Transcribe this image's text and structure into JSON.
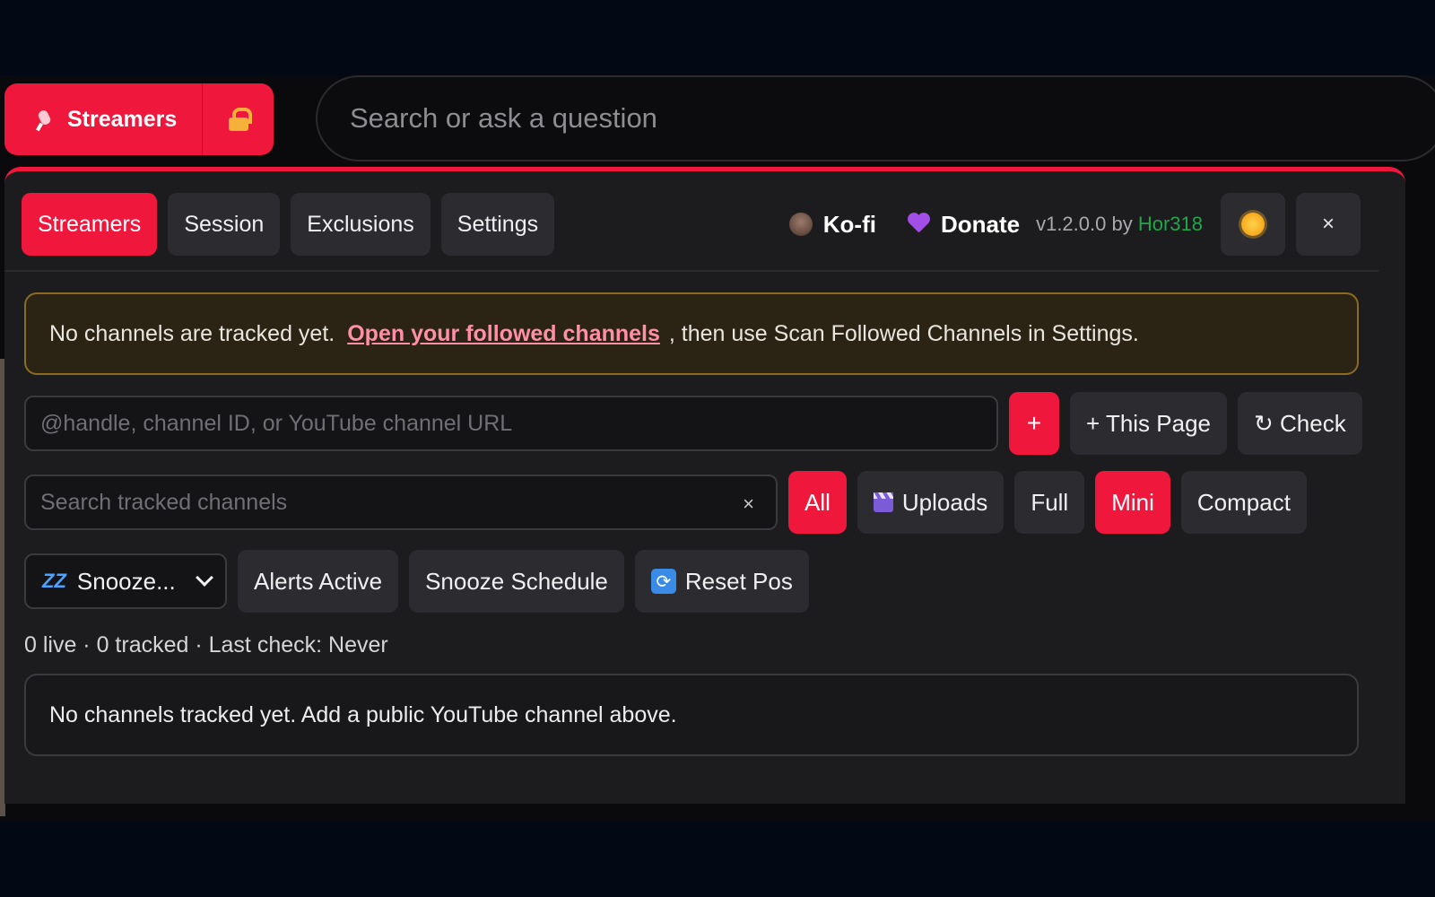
{
  "topbar": {
    "app_button_label": "Streamers",
    "app_button_icon": "microphone-icon",
    "lock_icon": "lock-icon",
    "search_placeholder": "Search or ask a question"
  },
  "tabs": [
    {
      "label": "Streamers",
      "active": true
    },
    {
      "label": "Session",
      "active": false
    },
    {
      "label": "Exclusions",
      "active": false
    },
    {
      "label": "Settings",
      "active": false
    }
  ],
  "header": {
    "kofi_label": "Ko-fi",
    "donate_label": "Donate",
    "version_prefix": "v1.2.0.0 by",
    "author": "Hor318",
    "theme_icon": "sun-icon",
    "close_label": "×"
  },
  "notice": {
    "text_before": "No channels are tracked yet.",
    "link_text": "Open your followed channels",
    "text_after": ", then use Scan Followed Channels in Settings."
  },
  "add_channel": {
    "placeholder": "@handle, channel ID, or YouTube channel URL",
    "add_label": "+",
    "this_page_label": "+ This Page",
    "check_label": "↻ Check"
  },
  "filter": {
    "search_placeholder": "Search tracked channels",
    "clear_label": "×",
    "all_label": "All",
    "uploads_label": "Uploads",
    "full_label": "Full",
    "mini_label": "Mini",
    "compact_label": "Compact"
  },
  "controls": {
    "snooze_value": "Snooze...",
    "alerts_label": "Alerts Active",
    "schedule_label": "Snooze Schedule",
    "reset_label": "Reset Pos"
  },
  "status_text": "0 live · 0 tracked · Last check: Never",
  "empty_text": "No channels tracked yet. Add a public YouTube channel above.",
  "colors": {
    "accent": "#f0173d",
    "author": "#1fa64a",
    "notice_border": "#8a6b22"
  }
}
